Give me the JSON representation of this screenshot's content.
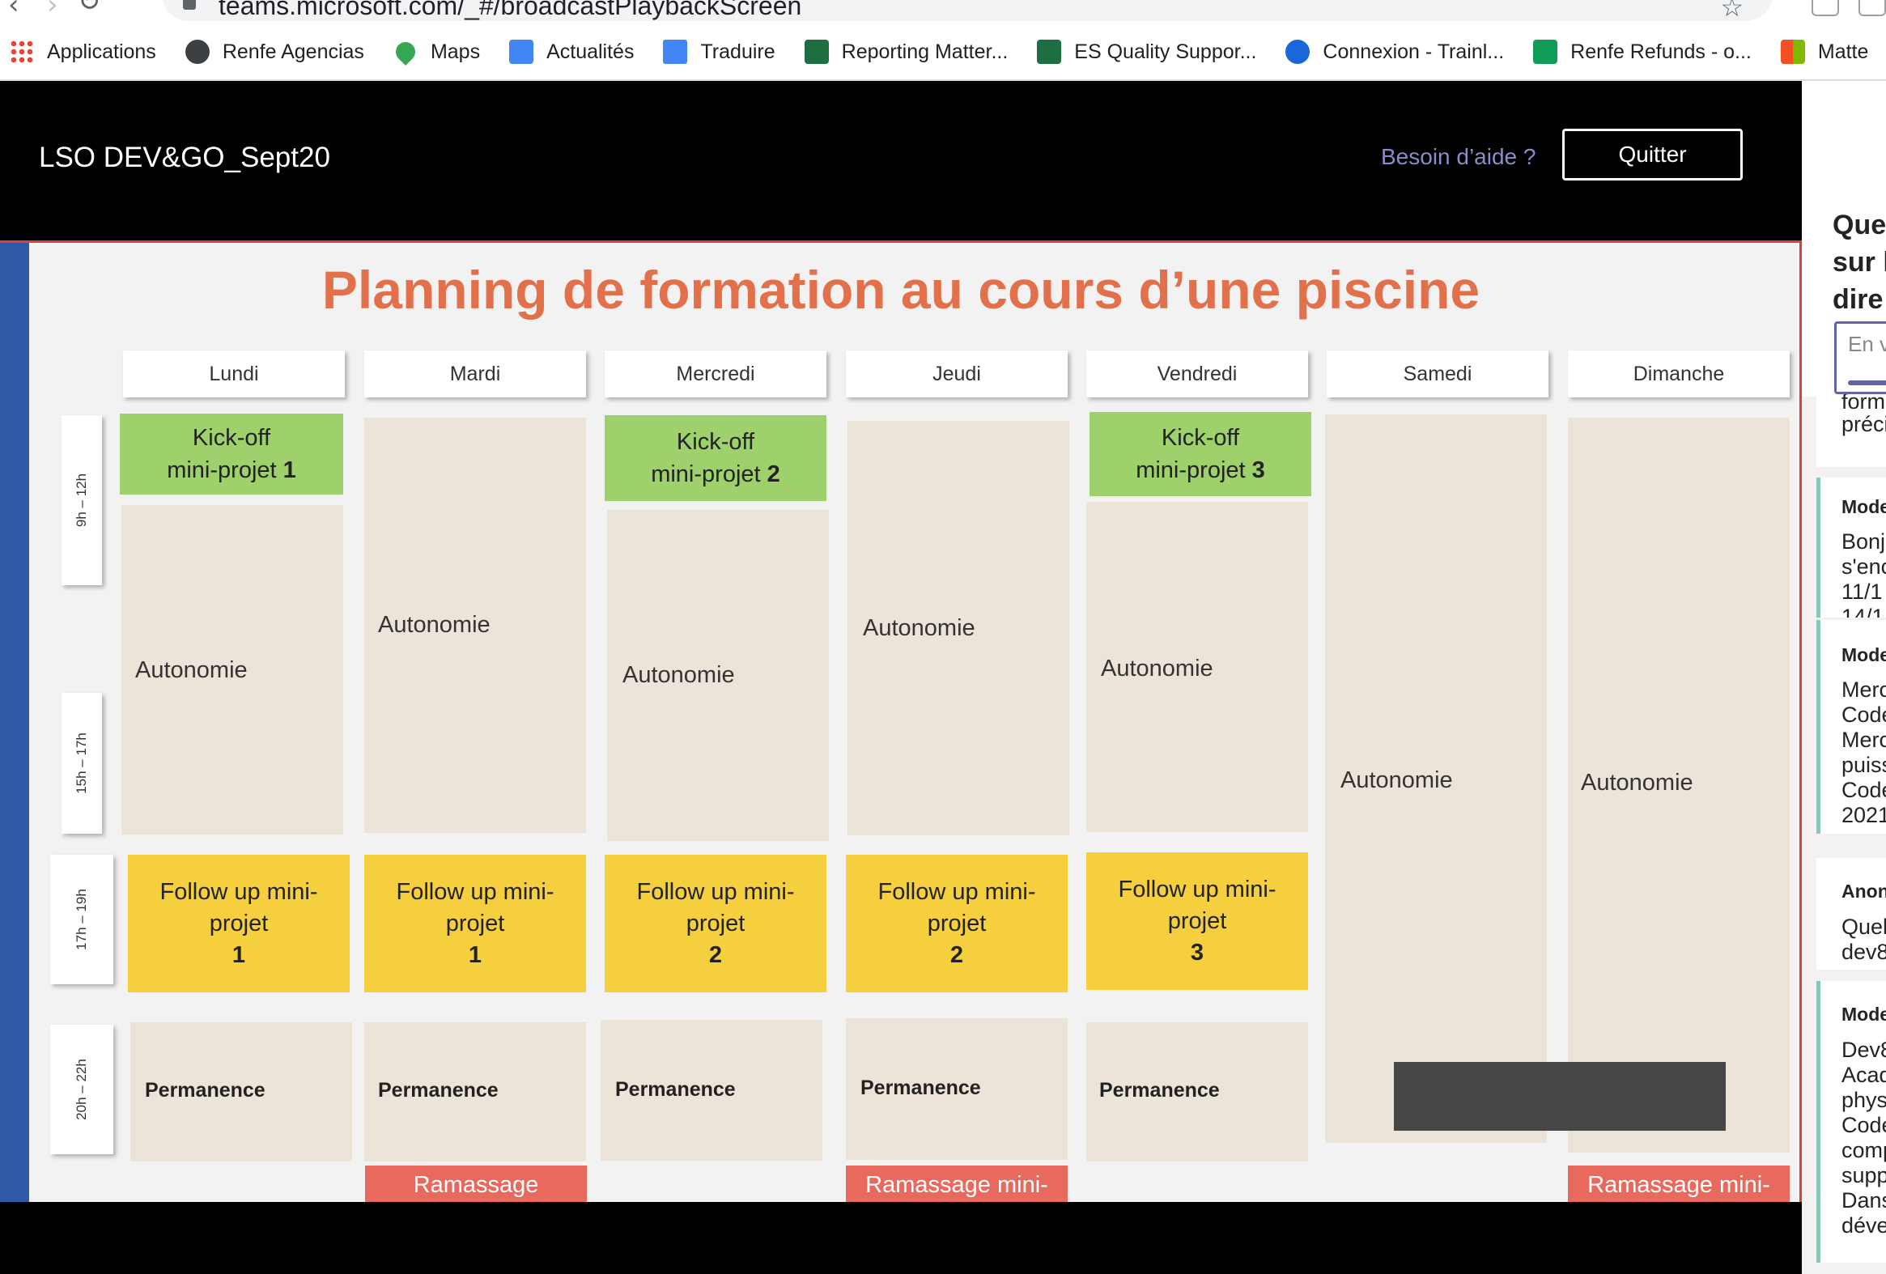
{
  "browser": {
    "url": "teams.microsoft.com/_#/broadcastPlaybackScreen",
    "bookmarks": [
      {
        "label": "Applications",
        "icon": "apps-grid-icon"
      },
      {
        "label": "Renfe Agencias",
        "icon": "globe-icon"
      },
      {
        "label": "Maps",
        "icon": "maps-pin-icon"
      },
      {
        "label": "Actualités",
        "icon": "news-icon"
      },
      {
        "label": "Traduire",
        "icon": "translate-icon"
      },
      {
        "label": "Reporting Matter...",
        "icon": "excel-icon"
      },
      {
        "label": "ES Quality Suppor...",
        "icon": "excel-icon"
      },
      {
        "label": "Connexion - Trainl...",
        "icon": "confluence-icon"
      },
      {
        "label": "Renfe Refunds - o...",
        "icon": "sheets-icon"
      },
      {
        "label": "Matte",
        "icon": "microsoft-icon"
      }
    ]
  },
  "header": {
    "title": "LSO DEV&GO_Sept20",
    "help": "Besoin d’aide ?",
    "quit": "Quitter"
  },
  "slide": {
    "title": "Planning de formation au cours d’une piscine",
    "days": [
      "Lundi",
      "Mardi",
      "Mercredi",
      "Jeudi",
      "Vendredi",
      "Samedi",
      "Dimanche"
    ],
    "times": [
      "9h – 12h",
      "15h – 17h",
      "17h – 19h",
      "20h – 22h"
    ],
    "kickoffs": [
      {
        "line1": "Kick-off",
        "line2": "mini-projet",
        "num": "1"
      },
      {
        "line1": "Kick-off",
        "line2": "mini-projet",
        "num": "2"
      },
      {
        "line1": "Kick-off",
        "line2": "mini-projet",
        "num": "3"
      }
    ],
    "autonomie": "Autonomie",
    "follow_line1": "Follow up mini-",
    "follow_line2": "projet",
    "follow_nums": [
      "1",
      "1",
      "2",
      "2",
      "3"
    ],
    "permanence": "Permanence",
    "ramassage": [
      "Ramassage",
      "Ramassage mini-",
      "Ramassage mini-"
    ]
  },
  "qa_panel": {
    "heading": [
      "Que",
      "sur l",
      "dire"
    ],
    "input_placeholder": "En v",
    "cards": [
      {
        "author": "",
        "lines": [
          "form",
          "préci"
        ]
      },
      {
        "author": "Mode",
        "lines": [
          "Bonjo",
          "s'enc",
          "11/1",
          "14/1"
        ]
      },
      {
        "author": "Mode",
        "lines": [
          "Merc",
          "Code",
          "Merc",
          "puiss",
          "Code",
          "2021"
        ]
      },
      {
        "author": "Anon",
        "lines": [
          "Quel",
          "dev8"
        ]
      },
      {
        "author": "Mode",
        "lines": [
          "Dev8",
          "Acad",
          "phys",
          "Code",
          "comp",
          "supp",
          "Dans",
          "déve"
        ]
      }
    ]
  }
}
